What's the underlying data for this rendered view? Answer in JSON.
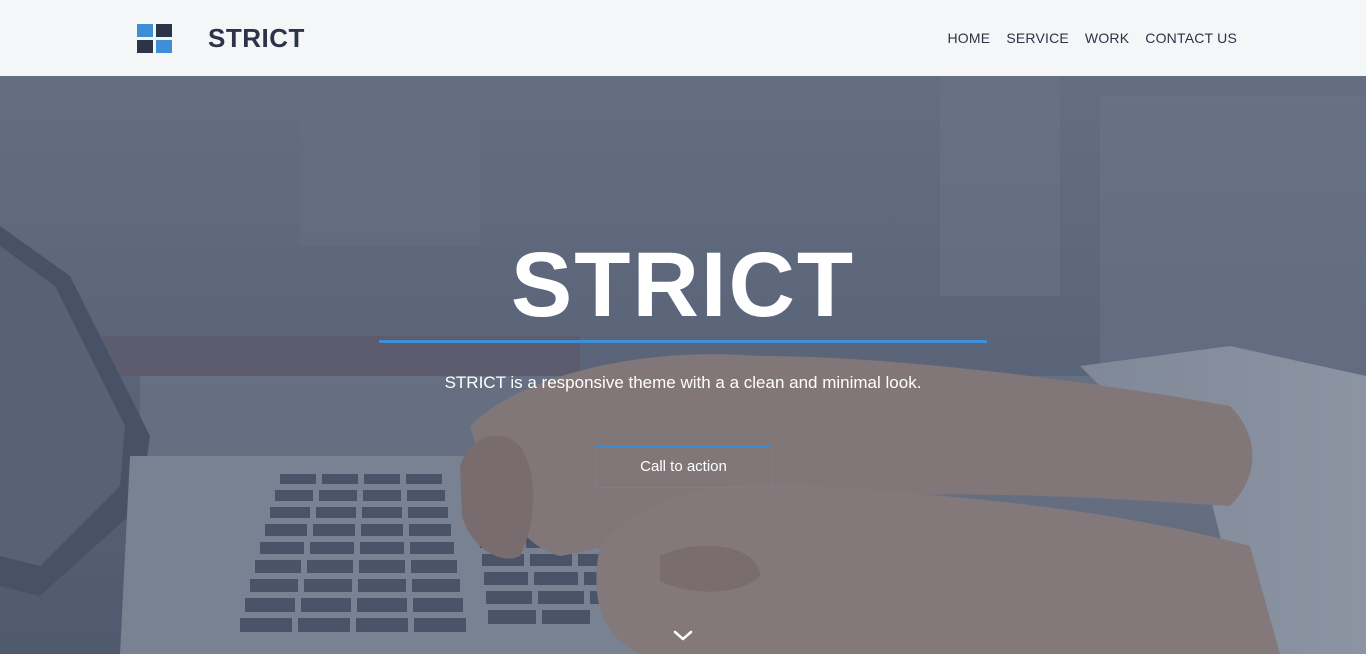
{
  "brand": {
    "name": "STRICT",
    "logo_icon": "four-squares-logo-icon",
    "colors": {
      "dark": "#2c3447",
      "accent": "#3f8ed8"
    }
  },
  "nav": {
    "items": [
      {
        "label": "HOME"
      },
      {
        "label": "SERVICE"
      },
      {
        "label": "WORK"
      },
      {
        "label": "CONTACT US"
      }
    ]
  },
  "hero": {
    "title": "STRICT",
    "subtitle": "STRICT is a responsive theme with a a clean and minimal look.",
    "cta_label": "Call to action",
    "scroll_icon": "chevron-down-icon",
    "background": "laptop-typing-photo"
  }
}
